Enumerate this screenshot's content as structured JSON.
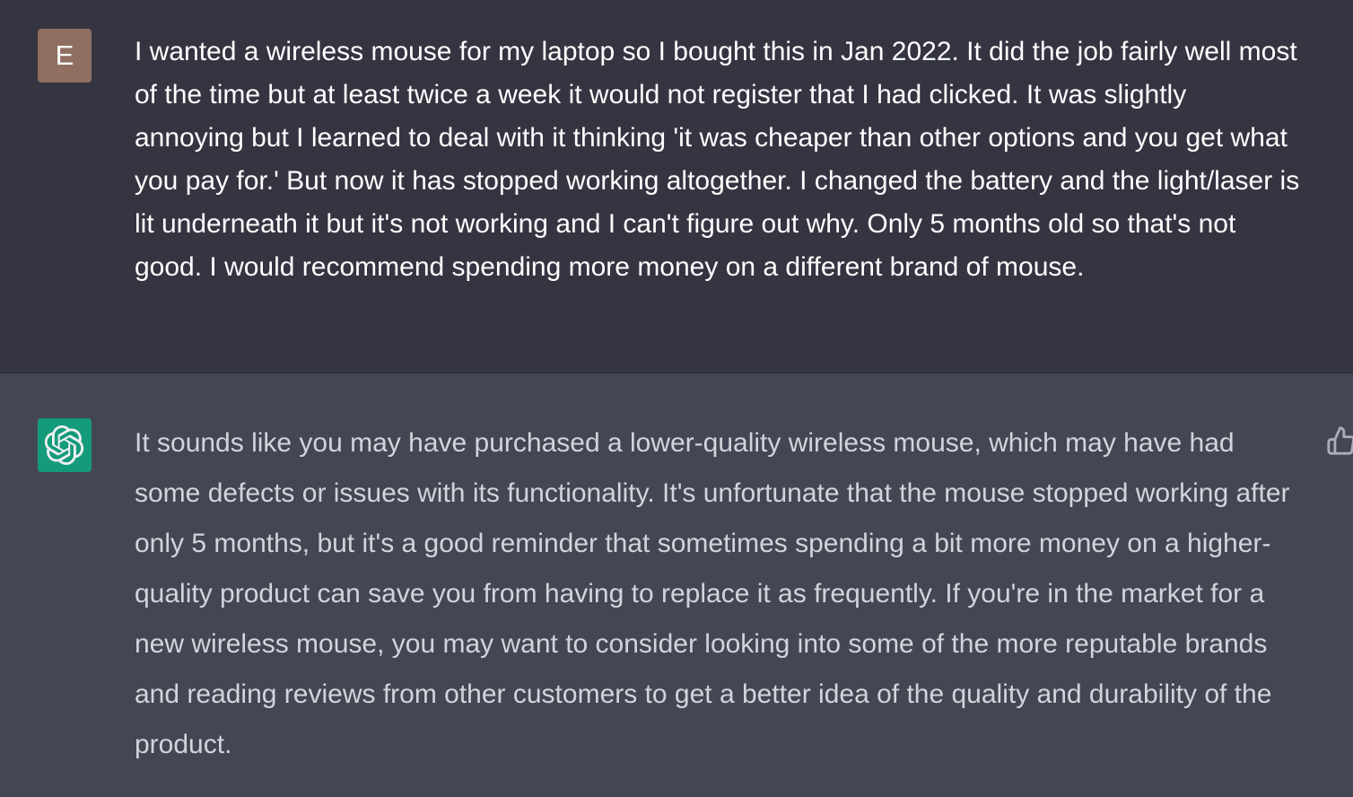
{
  "user_message": {
    "avatar_letter": "E",
    "avatar_color": "#8e6f62",
    "text": "I wanted a wireless mouse for my laptop so I bought this in Jan 2022. It did the job fairly well most of the time but at least twice a week it would not register that I had clicked. It was slightly annoying but I learned to deal with it thinking 'it was cheaper than other options and you get what you pay for.' But now it has stopped working altogether. I changed the battery and the light/laser is lit underneath it but it's not working and I can't figure out why. Only 5 months old so that's not good. I would recommend spending more money on a different brand of mouse."
  },
  "assistant_message": {
    "avatar_icon": "openai-logo-icon",
    "avatar_color": "#10a37f",
    "text": "It sounds like you may have purchased a lower-quality wireless mouse, which may have had some defects or issues with its functionality. It's unfortunate that the mouse stopped working after only 5 months, but it's a good reminder that sometimes spending a bit more money on a higher-quality product can save you from having to replace it as frequently. If you're in the market for a new wireless mouse, you may want to consider looking into some of the more reputable brands and reading reviews from other customers to get a better idea of the quality and durability of the product.",
    "feedback_icon": "thumbs-up-icon"
  },
  "colors": {
    "user_bg": "#343541",
    "assistant_bg": "#444654",
    "text_primary": "#ececf1"
  }
}
